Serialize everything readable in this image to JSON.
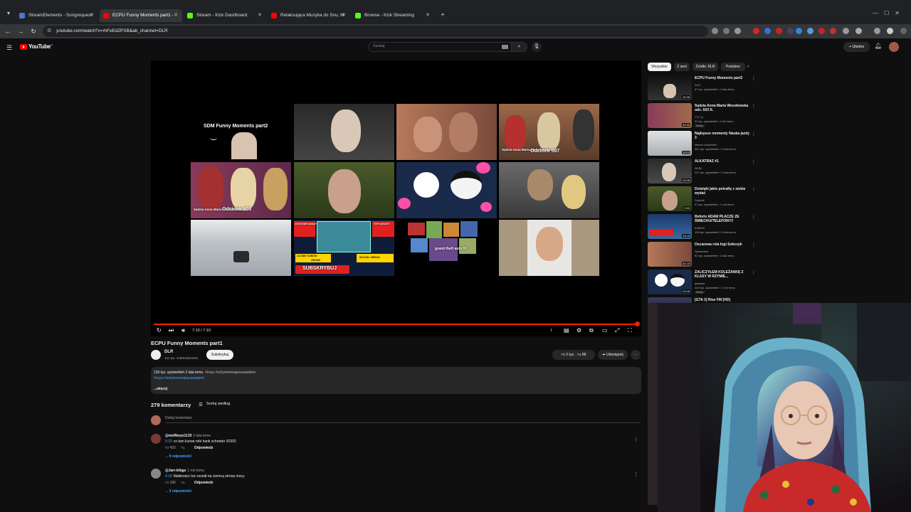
{
  "browser": {
    "tabs": [
      {
        "title": "StreamElements - Songrequest",
        "color": "#4a76d4",
        "active": false
      },
      {
        "title": "ECPU Funny Moments part1 -",
        "color": "#ff0000",
        "active": true
      },
      {
        "title": "Stream - Kick Dashboard",
        "color": "#53fc18",
        "active": false
      },
      {
        "title": "Relaksująca Muzyka do Snu, M",
        "color": "#ff0000",
        "active": false
      },
      {
        "title": "Browse - Kick Streaming",
        "color": "#53fc18",
        "active": false
      }
    ],
    "url": "youtube.com/watch?v=rhFeEd2PXB&ab_channel=DLR"
  },
  "youtube": {
    "logo_text": "YouTube",
    "region": "PL",
    "search_placeholder": "Szukaj",
    "create_label": "Utwórz"
  },
  "player": {
    "time": "7:10 / 7:10",
    "collage_title": "SDM Funny Moments part2",
    "labels": {
      "odcinek597": "Odcinek 597",
      "odcinek603": "Odcinek 603",
      "sedzia1": "Sędzia Anna Maria Wesołowska",
      "sedzia2": "Sędzia Anna Maria Wesołowska",
      "ostatnie": "OSTATNIE DONATY",
      "top": "TOP DONATY",
      "licznik": "LICZNIK SUBÓW",
      "licznik_val": "258.838",
      "social": "SOCIAL MEDIA",
      "subskrybuj": "SUBSKRYBUJ",
      "gta": "grand theft auto IV"
    }
  },
  "video": {
    "title": "ECPU Funny Moments part1",
    "channel": "DLR",
    "subs": "121 tys. subskrybentów",
    "subscribe": "Subskrybuj",
    "likes": "2 tys.",
    "dislikes": "68",
    "share": "Udostępnij",
    "more": "···",
    "desc_line1": "130 tys. wyświetleń  2 lata temu",
    "desc_tags1": "#ecpu #sztywnemajaszasadami",
    "desc_tags2": "#ecpu #sztywnemajaszasadami",
    "desc_more": "...więcej"
  },
  "comments": {
    "count": "279 komentarzy",
    "sort": "Sortuj według",
    "add_placeholder": "Dodaj komentarz",
    "items": [
      {
        "author": "@wolfboys1133",
        "time": "2 lata temu",
        "ts": "5:29",
        "text": "co tam kurwa robi hank schrader XDDD",
        "likes": "425",
        "reply": "Odpowiedz",
        "replies": "9 odpowiedzi",
        "avatar_color": "#7a3a3a"
      },
      {
        "author": "@Jarr-ktbgs",
        "time": "1 rok temu",
        "ts": "4:39",
        "text": "Makłowicz też zszedł na ciemną stronę mocy",
        "likes": "186",
        "reply": "Odpowiedz",
        "replies": "3 odpowiedzi",
        "avatar_color": "#888888"
      }
    ]
  },
  "sidebar": {
    "chips": [
      "Wszystkie",
      "Z serii",
      "Źródło: DLR",
      "Podobne"
    ],
    "recommendations": [
      {
        "title": "ECPU Funny Moments part2",
        "channel": "DLR",
        "meta": "67 tys. wyświetleń • 2 lata temu",
        "duration": "10:38",
        "badge": ""
      },
      {
        "title": "Sędzia Anna Maria Wesołowska odc. 603 ft.",
        "channel": "TTV ◎",
        "meta": "33 tys. wyświetleń • 2 dni temu",
        "duration": "42:53",
        "badge": "Nowy"
      },
      {
        "title": "Najlepsze momenty Nauka jazdy 3",
        "channel": "Marcin Gadziński",
        "meta": "367 tys. wyświetleń • 4 lata temu",
        "duration": "10:03",
        "badge": ""
      },
      {
        "title": "ALKATRAZ #1",
        "channel": "NOBI",
        "meta": "247 tys. wyświetleń • 2 lata temu",
        "duration": "10:08",
        "badge": ""
      },
      {
        "title": "Dziwięki jakie potrafię z siebie wydać",
        "channel": "Szybcik",
        "meta": "37 tys. wyświetleń • 1 rok temu",
        "duration": "3:59",
        "badge": ""
      },
      {
        "title": "Reforix ADAM PŁACZE ZE ŚMIECHU/TELEFON!!!!",
        "channel": "KUBOX",
        "meta": "109 tys. wyświetleń • 2 lata temu",
        "duration": "13:18",
        "badge": ""
      },
      {
        "title": "Oscarowa rola Ingi Sobczyk",
        "channel": "Syntezator",
        "meta": "92 tys. wyświetleń • 2 lata temu",
        "duration": "42:18",
        "badge": ""
      },
      {
        "title": "ZALICZYŁEM KOLEŻANKĘ Z KLASY W RZYMIE...",
        "channel": "qwassie",
        "meta": "240 tys. wyświetleń • 2 dni temu",
        "duration": "23:28",
        "badge": "Nowy"
      },
      {
        "title": "[GTA 3] Rise FM [HD]",
        "channel": "",
        "meta": "",
        "duration": "",
        "badge": ""
      }
    ]
  },
  "colors": {
    "accent": "#ff0000",
    "link": "#3ea6ff",
    "bg": "#0f0f0f"
  }
}
